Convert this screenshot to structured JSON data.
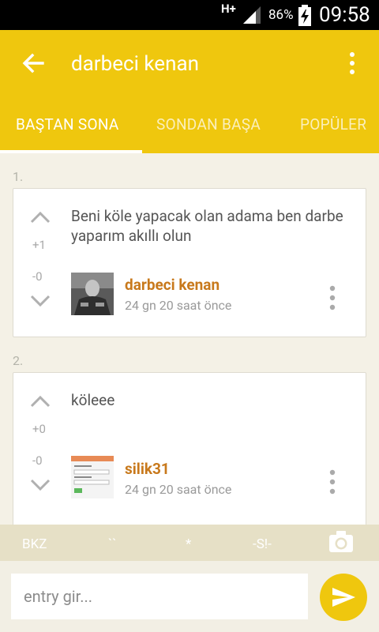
{
  "status_bar": {
    "network": "H+",
    "battery_percent": "86%",
    "time": "09:58"
  },
  "app_bar": {
    "title": "darbeci kenan"
  },
  "tabs": [
    {
      "label": "BAŞTAN SONA",
      "active": true
    },
    {
      "label": "SONDAN BAŞA",
      "active": false
    },
    {
      "label": "POPÜLER",
      "active": false
    }
  ],
  "entries": [
    {
      "number": "1.",
      "text": "Beni köle yapacak olan adama ben darbe yaparım akıllı olun",
      "up_count": "+1",
      "down_count": "-0",
      "author": "darbeci kenan",
      "time_ago": "24 gn 20 saat  önce"
    },
    {
      "number": "2.",
      "text": "köleee",
      "up_count": "+0",
      "down_count": "-0",
      "author": "silik31",
      "time_ago": "24 gn 20 saat  önce"
    }
  ],
  "shortcuts": [
    "BKZ",
    "``",
    "*",
    "-S!-"
  ],
  "input": {
    "placeholder": "entry gir..."
  },
  "colors": {
    "accent": "#efc70e",
    "author": "#c8791c",
    "background": "#f4f1e6"
  }
}
